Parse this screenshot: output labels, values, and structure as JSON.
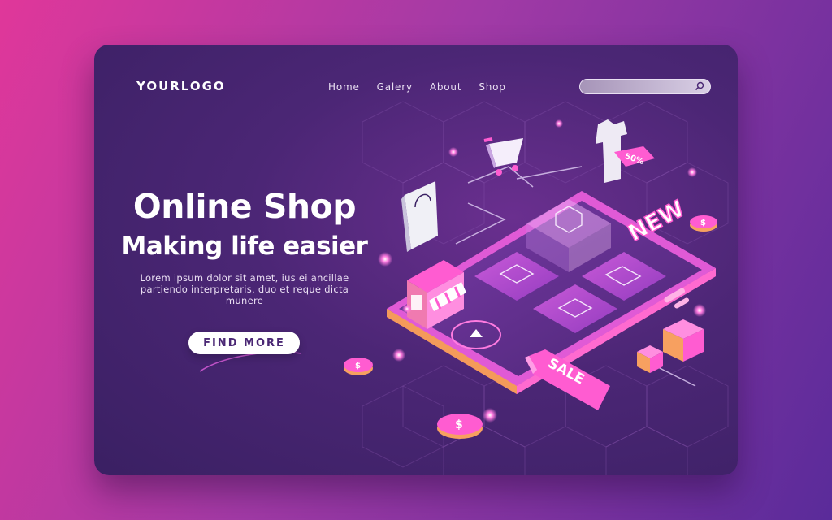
{
  "header": {
    "logo": "YOURLOGO",
    "nav": [
      "Home",
      "Galery",
      "About",
      "Shop"
    ],
    "search": {
      "placeholder": "",
      "icon": "search-icon"
    }
  },
  "hero": {
    "title": "Online Shop",
    "subtitle": "Making life easier",
    "description": "Lorem ipsum dolor sit amet, ius ei ancillae partiendo interpretaris, duo et reque dicta munere",
    "cta_label": "FIND MORE"
  },
  "illustration": {
    "new_label": "NEW",
    "sale_label": "SALE",
    "discount_label": "50%",
    "coin_symbol": "$",
    "colors": {
      "accent": "#e83bd2",
      "orange": "#f7a060",
      "pink": "#ff5cd1"
    }
  }
}
